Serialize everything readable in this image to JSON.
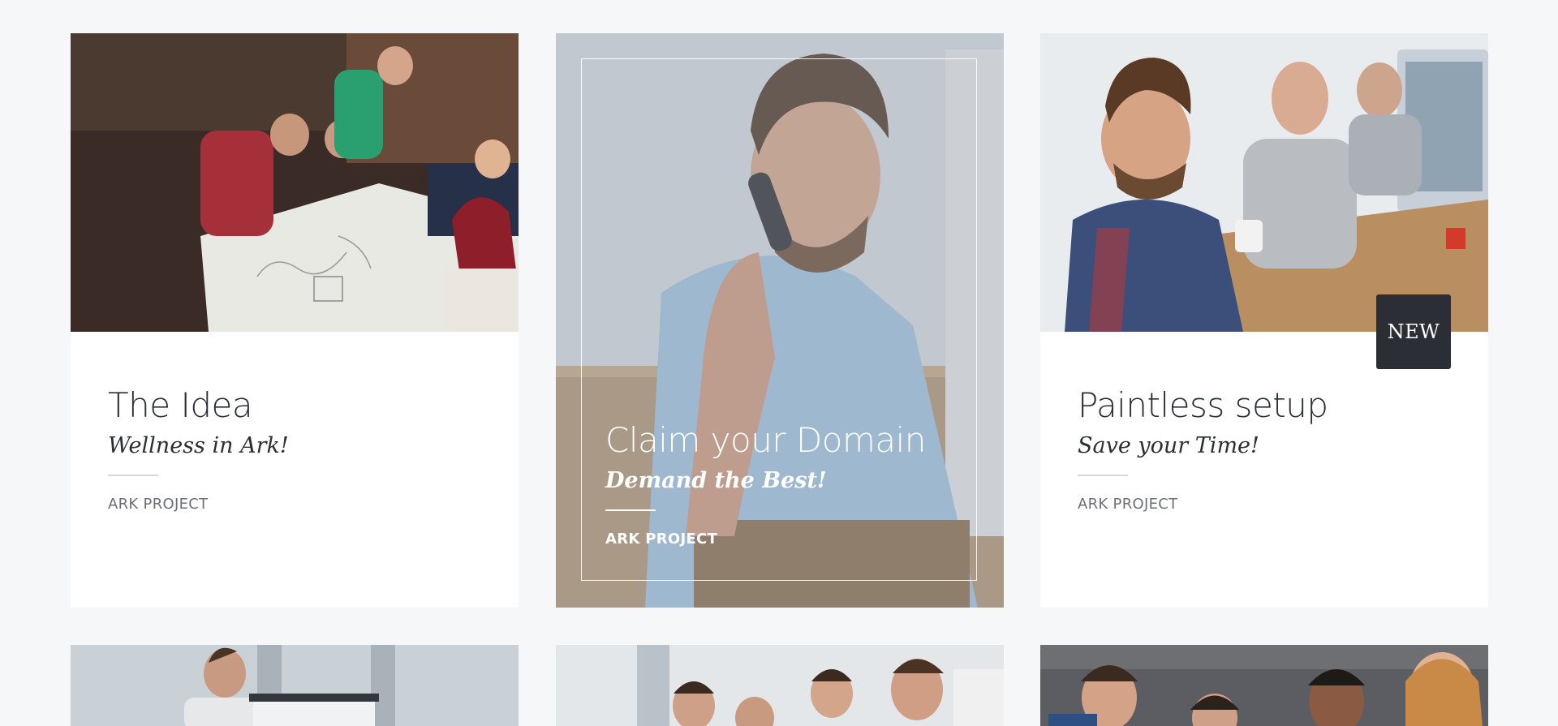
{
  "cards": [
    {
      "title": "The Idea",
      "subtitle": "Wellness in Ark!",
      "meta": "ARK PROJECT",
      "image": "team brainstorming over whiteboard table"
    },
    {
      "title": "Claim your Domain",
      "subtitle": "Demand the Best!",
      "meta": "ARK PROJECT",
      "image": "man on phone call",
      "overlay_color": "#9aa3ad"
    },
    {
      "title": "Paintless setup",
      "subtitle": "Save your Time!",
      "meta": "ARK PROJECT",
      "image": "smiling team at office desk",
      "badge": "NEW"
    }
  ],
  "row2_images": [
    "man presenting at flipchart",
    "team gathered around laptop",
    "group meeting in office"
  ],
  "colors": {
    "page_bg": "#f6f7f9",
    "card_bg": "#ffffff",
    "text_dark": "#2b2e34",
    "text_muted": "#6b6f77",
    "badge_bg": "#2c2e35"
  }
}
